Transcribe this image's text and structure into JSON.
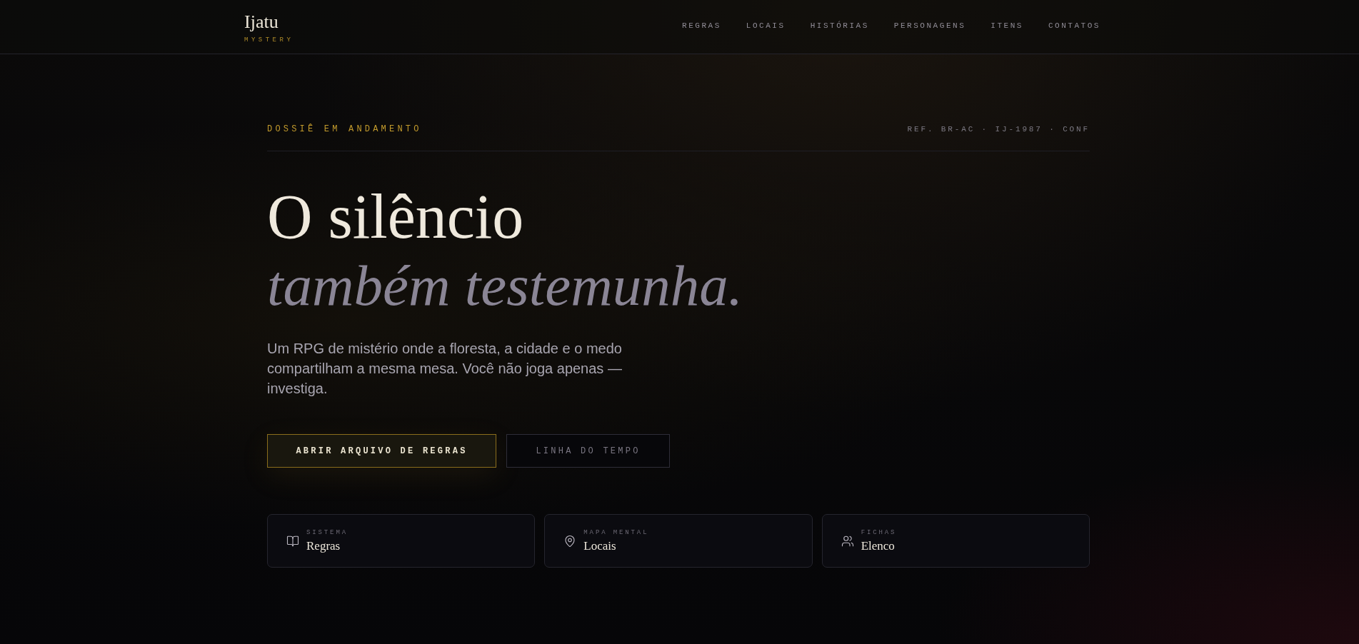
{
  "header": {
    "logo": {
      "name": "Ijatu",
      "tagline": "MYSTERY"
    },
    "nav": [
      {
        "label": "REGRAS"
      },
      {
        "label": "LOCAIS"
      },
      {
        "label": "HISTÓRIAS"
      },
      {
        "label": "PERSONAGENS"
      },
      {
        "label": "ITENS"
      },
      {
        "label": "CONTATOS"
      }
    ]
  },
  "hero": {
    "eyebrow": "DOSSIÊ EM ANDAMENTO",
    "reference": "REF. BR-AC · IJ-1987 · CONF",
    "title_line_1": "O silêncio",
    "title_line_2": "também testemunha.",
    "description": "Um RPG de mistério onde a floresta, a cidade e o medo compartilham a mesma mesa. Você não joga apenas — investiga.",
    "buttons": [
      {
        "label": "ABRIR ARQUIVO DE REGRAS",
        "kind": "primary"
      },
      {
        "label": "LINHA DO TEMPO",
        "kind": "secondary"
      }
    ]
  },
  "cards": [
    {
      "label": "SISTEMA",
      "title": "Regras"
    },
    {
      "label": "MAPA MENTAL",
      "title": "Locais"
    },
    {
      "label": "FICHAS",
      "title": "Elenco"
    }
  ]
}
